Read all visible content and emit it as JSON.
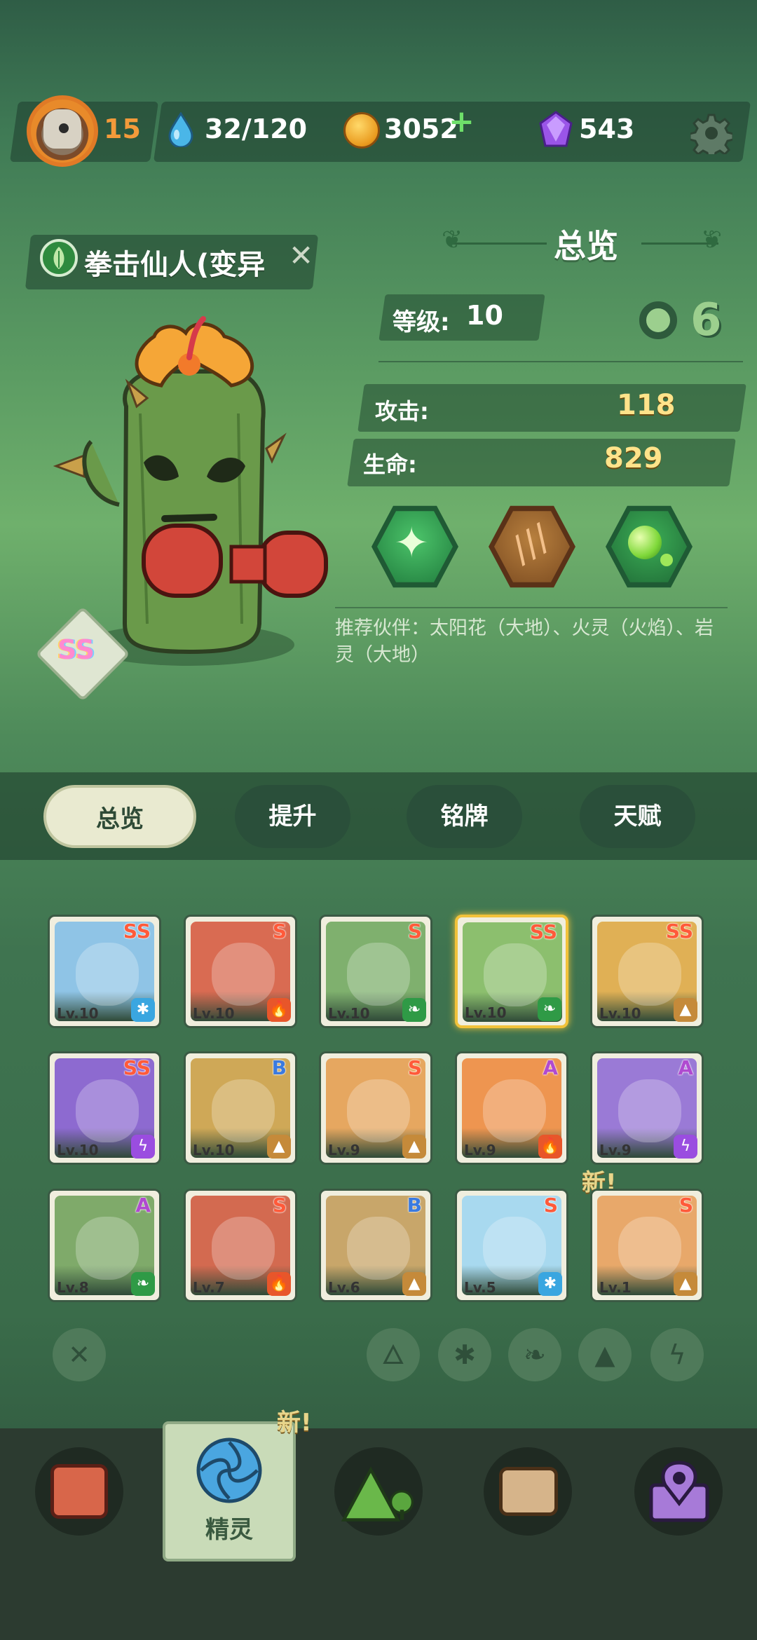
{
  "header": {
    "player_level": "15",
    "energy": "32/120",
    "coins": "3052",
    "gems": "543"
  },
  "spirit": {
    "name": "拳击仙人(变异",
    "rarity": "SS",
    "level_label": "等级:",
    "level_value": "10",
    "attack_label": "攻击:",
    "attack_value": "118",
    "hp_label": "生命:",
    "hp_value": "829",
    "recommend_text": "推荐伙伴：太阳花（大地）、火灵（火焰）、岩灵（大地）"
  },
  "section_title": "总览",
  "tabs": [
    {
      "label": "总览",
      "active": true
    },
    {
      "label": "提升",
      "active": false
    },
    {
      "label": "铭牌",
      "active": false
    },
    {
      "label": "天赋",
      "active": false
    }
  ],
  "cards": [
    {
      "lv": "Lv.10",
      "rank": "SS",
      "element": "ice",
      "bg": "#8fc4e6"
    },
    {
      "lv": "Lv.10",
      "rank": "S",
      "element": "fire",
      "bg": "#d96b52"
    },
    {
      "lv": "Lv.10",
      "rank": "S",
      "element": "leaf",
      "bg": "#7fb06e"
    },
    {
      "lv": "Lv.10",
      "rank": "SS",
      "element": "leaf",
      "bg": "#8cbf6e",
      "selected": true
    },
    {
      "lv": "Lv.10",
      "rank": "SS",
      "element": "earth",
      "bg": "#e0b055"
    },
    {
      "lv": "Lv.10",
      "rank": "SS",
      "element": "thunder",
      "bg": "#8d6ad0"
    },
    {
      "lv": "Lv.10",
      "rank": "B",
      "element": "earth",
      "bg": "#cfa857"
    },
    {
      "lv": "Lv.9",
      "rank": "S",
      "element": "earth",
      "bg": "#e6a760"
    },
    {
      "lv": "Lv.9",
      "rank": "A",
      "element": "fire",
      "bg": "#ee9550"
    },
    {
      "lv": "Lv.9",
      "rank": "A",
      "element": "thunder",
      "bg": "#9a7ad6"
    },
    {
      "lv": "Lv.8",
      "rank": "A",
      "element": "leaf",
      "bg": "#7faa6a"
    },
    {
      "lv": "Lv.7",
      "rank": "S",
      "element": "fire",
      "bg": "#d36a50"
    },
    {
      "lv": "Lv.6",
      "rank": "B",
      "element": "earth",
      "bg": "#c8a66a"
    },
    {
      "lv": "Lv.5",
      "rank": "S",
      "element": "ice",
      "bg": "#a8d9ef"
    },
    {
      "lv": "Lv.1",
      "rank": "S",
      "element": "earth",
      "bg": "#e8a86a",
      "new": true
    }
  ],
  "new_label": "新!",
  "bottom_nav": {
    "active_label": "精灵",
    "new_label": "新!"
  },
  "colors": {
    "fire": "#e8562a",
    "leaf": "#2f9a46",
    "earth": "#c58a3a",
    "ice": "#3aa6e0",
    "thunder": "#9a4de0"
  }
}
